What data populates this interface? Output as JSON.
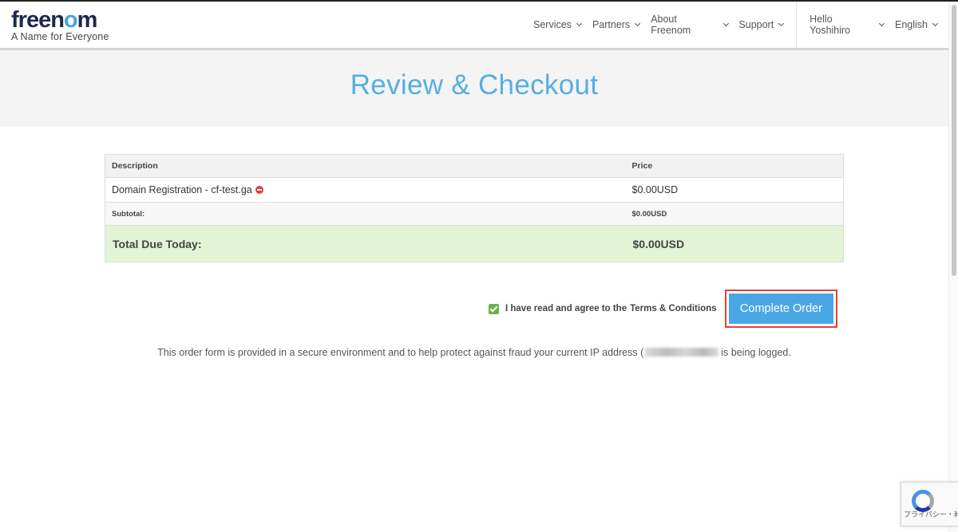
{
  "header": {
    "logo": {
      "brand_prefix": "free",
      "brand_o": "n",
      "brand_suffix": "m",
      "tagline": "A Name for Everyone",
      "o_letter": "o"
    },
    "nav": [
      {
        "label": "Services"
      },
      {
        "label": "Partners"
      },
      {
        "label": "About Freenom"
      },
      {
        "label": "Support"
      }
    ],
    "user_menu": {
      "label": "Hello Yoshihiro"
    },
    "language_menu": {
      "label": "English"
    }
  },
  "page": {
    "title": "Review & Checkout"
  },
  "order_table": {
    "columns": [
      "Description",
      "Price"
    ],
    "items": [
      {
        "description": "Domain Registration - cf-test.ga",
        "price": "$0.00USD"
      }
    ],
    "subtotal_label": "Subtotal:",
    "subtotal_value": "$0.00USD",
    "total_label": "Total Due Today:",
    "total_value": "$0.00USD"
  },
  "agreement": {
    "checked": true,
    "text": "I have read and agree to the",
    "link": "Terms & Conditions"
  },
  "complete_button": {
    "label": "Complete Order"
  },
  "secure_note": {
    "before": "This order form is provided in a secure environment and to help protect against fraud your current IP address (",
    "after": "is being logged."
  },
  "recaptcha": {
    "text": "プライバシー・利用規約"
  },
  "colors": {
    "accent": "#4aa7e6",
    "highlight": "#e0442e",
    "total_row": "#e3f3d5",
    "logo_dark": "#1c2a4b"
  }
}
